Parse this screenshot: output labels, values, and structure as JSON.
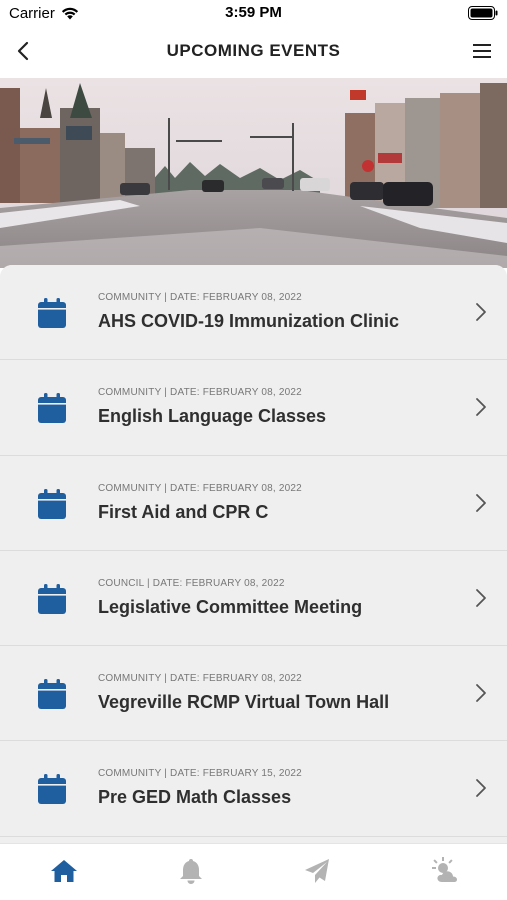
{
  "status_bar": {
    "carrier": "Carrier",
    "time": "3:59 PM"
  },
  "header": {
    "title": "UPCOMING EVENTS"
  },
  "events": [
    {
      "meta": "COMMUNITY | DATE: FEBRUARY 08, 2022",
      "title": "AHS COVID-19 Immunization Clinic"
    },
    {
      "meta": "COMMUNITY | DATE: FEBRUARY 08, 2022",
      "title": "English Language Classes"
    },
    {
      "meta": "COMMUNITY | DATE: FEBRUARY 08, 2022",
      "title": "First Aid and CPR C"
    },
    {
      "meta": "COUNCIL | DATE: FEBRUARY 08, 2022",
      "title": "Legislative Committee Meeting"
    },
    {
      "meta": "COMMUNITY | DATE: FEBRUARY 08, 2022",
      "title": "Vegreville RCMP Virtual Town Hall"
    },
    {
      "meta": "COMMUNITY | DATE: FEBRUARY 15, 2022",
      "title": "Pre GED Math Classes"
    }
  ],
  "tabs": [
    {
      "icon": "home-icon",
      "active": true
    },
    {
      "icon": "bell-icon",
      "active": false
    },
    {
      "icon": "paper-plane-icon",
      "active": false
    },
    {
      "icon": "weather-icon",
      "active": false
    }
  ],
  "colors": {
    "accent": "#1f5fa0",
    "inactive_tab": "#b3b3b3",
    "list_bg": "#efefef"
  }
}
